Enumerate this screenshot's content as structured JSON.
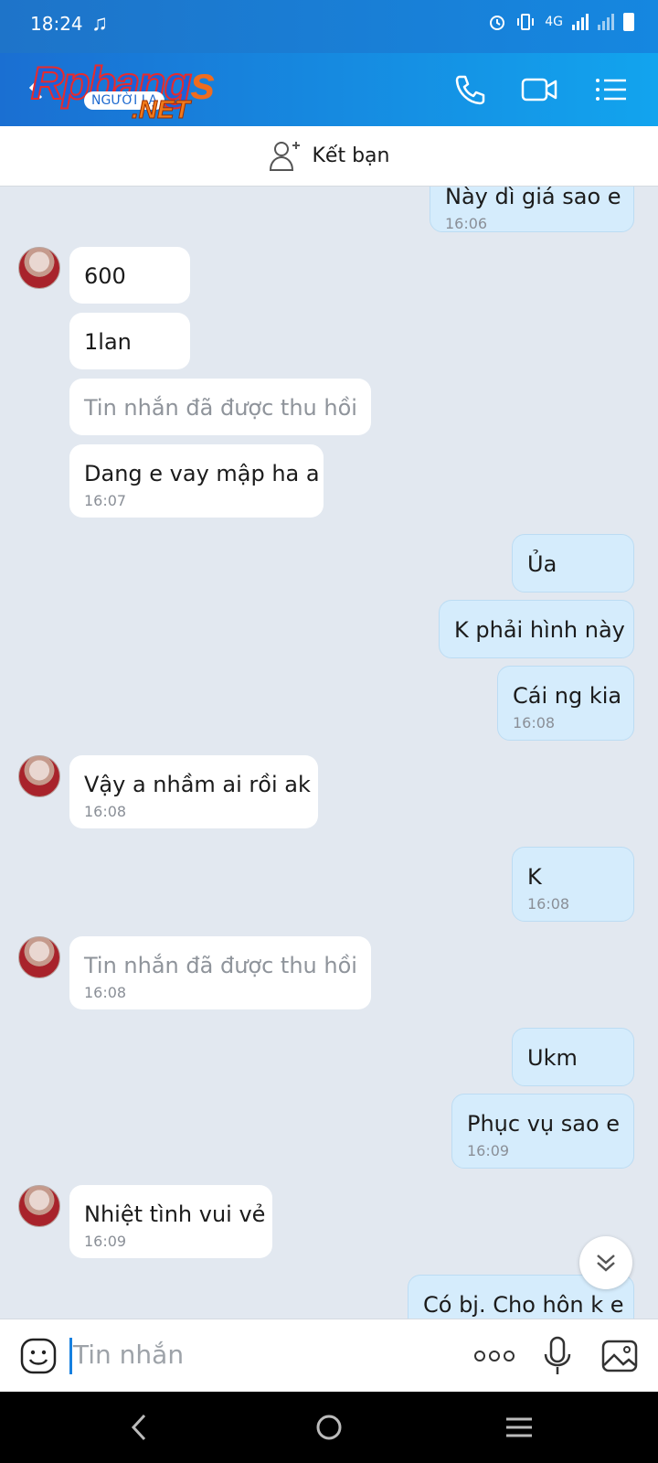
{
  "status": {
    "time": "18:24",
    "network": "4G"
  },
  "header": {
    "logo_main": "Rpbang",
    "logo_s": "s",
    "logo_badge": "NGƯỜI LẠ",
    "logo_net": ".NET"
  },
  "friend_bar": {
    "label": "Kết bạn"
  },
  "messages": [
    {
      "side": "out",
      "text": "Này dì giá sao e",
      "time": "16:06"
    },
    {
      "side": "in",
      "text": "600"
    },
    {
      "side": "in",
      "text": "1lan"
    },
    {
      "side": "in",
      "text": "Tin nhắn đã được thu hồi",
      "recalled": true
    },
    {
      "side": "in",
      "text": "Dang e vay mập ha a",
      "time": "16:07"
    },
    {
      "side": "out",
      "text": "Ủa"
    },
    {
      "side": "out",
      "text": "K phải hình này"
    },
    {
      "side": "out",
      "text": "Cái ng kia",
      "time": "16:08"
    },
    {
      "side": "in",
      "text": "Vậy a nhầm ai rồi ak",
      "time": "16:08"
    },
    {
      "side": "out",
      "text": "K",
      "time": "16:08"
    },
    {
      "side": "in",
      "text": "Tin nhắn đã được thu hồi",
      "time": "16:08",
      "recalled": true
    },
    {
      "side": "out",
      "text": "Ukm"
    },
    {
      "side": "out",
      "text": "Phục vụ sao e",
      "time": "16:09"
    },
    {
      "side": "in",
      "text": "Nhiệt tình vui vẻ",
      "time": "16:09"
    },
    {
      "side": "out",
      "text": "Có bj. Cho hôn k e"
    }
  ],
  "input": {
    "placeholder": "Tin nhắn"
  },
  "colors": {
    "header_start": "#1a6fd2",
    "header_end": "#12a4ee",
    "out_bubble": "#d5ecfc",
    "in_bubble": "#ffffff",
    "chat_bg": "#e2e8f0"
  }
}
